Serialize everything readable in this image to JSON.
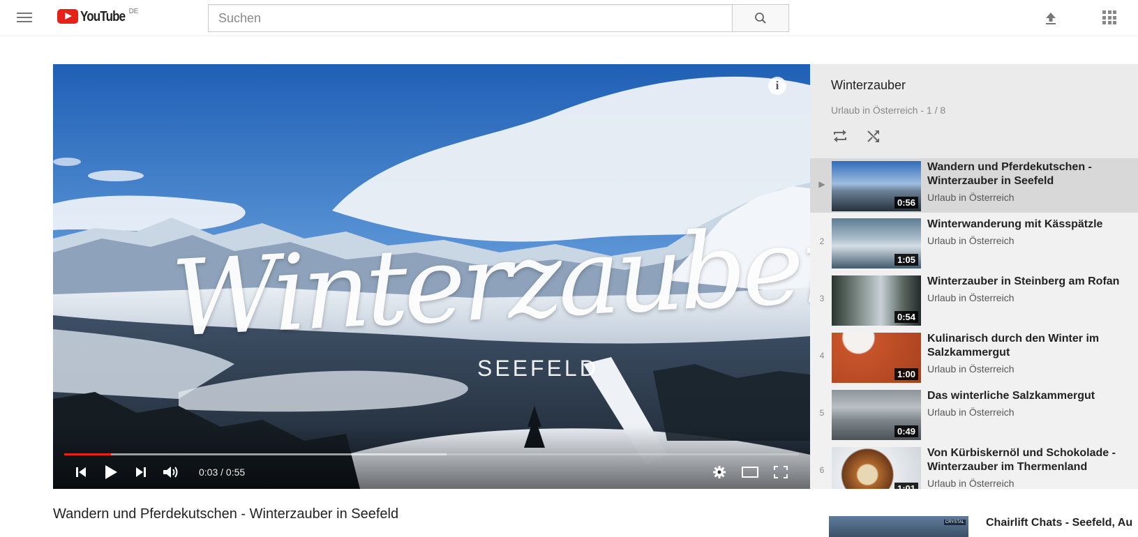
{
  "masthead": {
    "logo_text": "YouTube",
    "country_code": "DE",
    "search_placeholder": "Suchen",
    "search_value": ""
  },
  "player": {
    "overlay_title": "Winterzauber",
    "overlay_subtitle": "SEEFELD",
    "time_display": "0:03 / 0:55",
    "progress_fraction": 0.064,
    "buffered_fraction": 0.52,
    "info_glyph": "i"
  },
  "playlist": {
    "title": "Winterzauber",
    "subtitle": "Urlaub in Österreich - 1 / 8",
    "items": [
      {
        "index": "▶",
        "title": "Wandern und Pferdekutschen - Winterzauber in Seefeld",
        "channel": "Urlaub in Österreich",
        "duration": "0:56",
        "active": true
      },
      {
        "index": "2",
        "title": "Winterwanderung mit Kässpätzle",
        "channel": "Urlaub in Österreich",
        "duration": "1:05",
        "active": false
      },
      {
        "index": "3",
        "title": "Winterzauber in Steinberg am Rofan",
        "channel": "Urlaub in Österreich",
        "duration": "0:54",
        "active": false
      },
      {
        "index": "4",
        "title": "Kulinarisch durch den Winter im Salzkammergut",
        "channel": "Urlaub in Österreich",
        "duration": "1:00",
        "active": false
      },
      {
        "index": "5",
        "title": "Das winterliche Salzkammergut",
        "channel": "Urlaub in Österreich",
        "duration": "0:49",
        "active": false
      },
      {
        "index": "6",
        "title": "Von Kürbiskernöl und Schokolade - Winterzauber im Thermenland",
        "channel": "Urlaub in Österreich",
        "duration": "1:01",
        "active": false
      }
    ]
  },
  "watch": {
    "title": "Wandern und Pferdekutschen - Winterzauber in Seefeld"
  },
  "recommendation": {
    "title": "Chairlift Chats - Seefeld, Au",
    "thumb_badge": "CRYSTAL"
  },
  "colors": {
    "brand_red": "#e62117",
    "playlist_bg": "#f1f1f1",
    "active_item_bg": "#d8d8d8"
  },
  "icons": [
    "menu-icon",
    "search-icon",
    "upload-icon",
    "apps-icon",
    "info-icon",
    "prev-icon",
    "play-icon",
    "next-icon",
    "volume-icon",
    "settings-icon",
    "theater-icon",
    "fullscreen-icon",
    "loop-icon",
    "shuffle-icon"
  ]
}
